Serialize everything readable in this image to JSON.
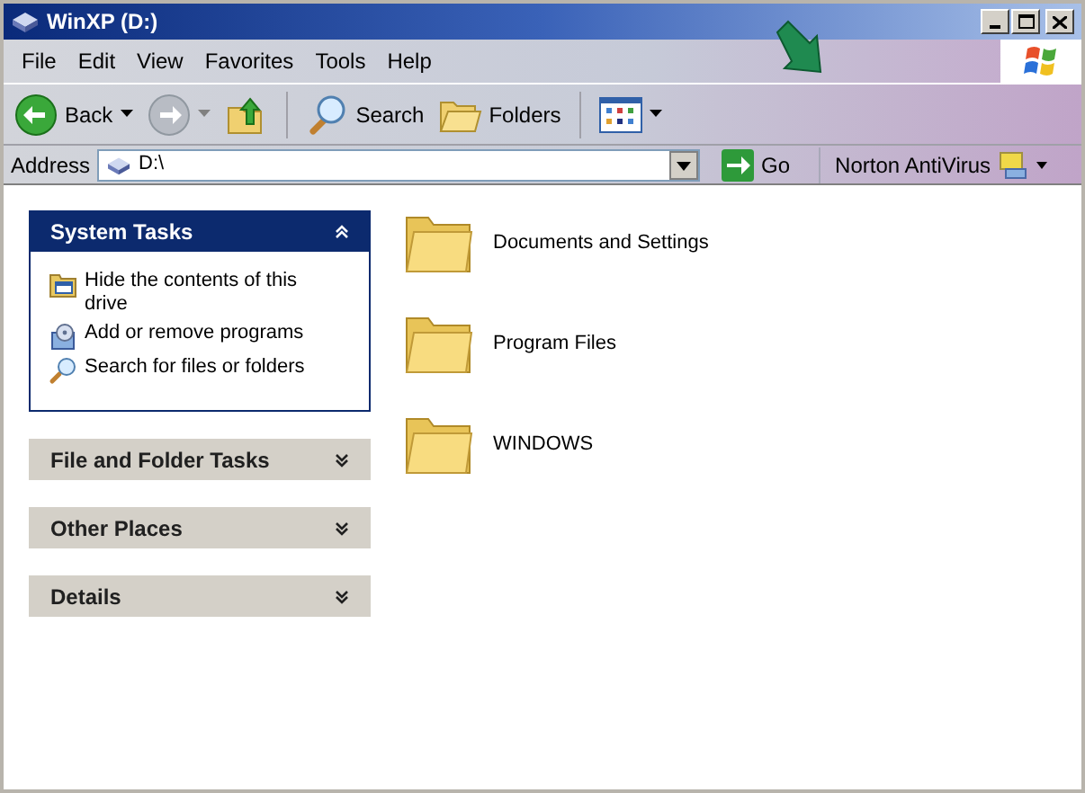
{
  "window": {
    "title": "WinXP (D:)"
  },
  "menu": [
    "File",
    "Edit",
    "View",
    "Favorites",
    "Tools",
    "Help"
  ],
  "toolbar": [
    {
      "kind": "back",
      "label": "Back",
      "disabled": false
    },
    {
      "kind": "forward",
      "disabled": true
    },
    {
      "kind": "up"
    },
    {
      "kind": "search",
      "label": "Search"
    },
    {
      "kind": "folders",
      "label": "Folders"
    },
    {
      "kind": "views"
    }
  ],
  "address": {
    "label": "Address",
    "value": "D:\\",
    "go": "Go",
    "norton": "Norton AntiVirus"
  },
  "sidebar": {
    "panels": [
      {
        "title": "System Tasks",
        "expanded": true,
        "items": [
          {
            "kind": "hide",
            "text": "Hide the contents of this drive"
          },
          {
            "kind": "addremove",
            "text": "Add or remove programs"
          },
          {
            "kind": "search",
            "text": "Search for files or folders"
          }
        ]
      },
      {
        "title": "File and Folder Tasks",
        "expanded": false
      },
      {
        "title": "Other Places",
        "expanded": false
      },
      {
        "title": "Details",
        "expanded": false
      }
    ]
  },
  "files": [
    {
      "name": "Documents and Settings"
    },
    {
      "name": "Program Files"
    },
    {
      "name": "WINDOWS"
    }
  ]
}
